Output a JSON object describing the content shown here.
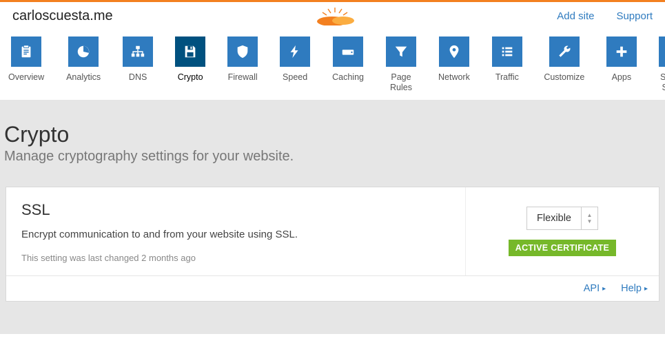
{
  "header": {
    "site_name": "carloscuesta.me",
    "links": {
      "add_site": "Add site",
      "support": "Support"
    }
  },
  "nav": {
    "items": [
      {
        "id": "overview",
        "label": "Overview",
        "icon": "clipboard"
      },
      {
        "id": "analytics",
        "label": "Analytics",
        "icon": "pie"
      },
      {
        "id": "dns",
        "label": "DNS",
        "icon": "sitemap"
      },
      {
        "id": "crypto",
        "label": "Crypto",
        "icon": "floppy",
        "active": true
      },
      {
        "id": "firewall",
        "label": "Firewall",
        "icon": "shield"
      },
      {
        "id": "speed",
        "label": "Speed",
        "icon": "bolt"
      },
      {
        "id": "caching",
        "label": "Caching",
        "icon": "drive"
      },
      {
        "id": "page-rules",
        "label": "Page Rules",
        "icon": "filter"
      },
      {
        "id": "network",
        "label": "Network",
        "icon": "pin"
      },
      {
        "id": "traffic",
        "label": "Traffic",
        "icon": "list"
      },
      {
        "id": "customize",
        "label": "Customize",
        "icon": "wrench"
      },
      {
        "id": "apps",
        "label": "Apps",
        "icon": "plus"
      },
      {
        "id": "scrape-shield",
        "label": "Scrape Shield",
        "icon": "doc"
      }
    ]
  },
  "page": {
    "title": "Crypto",
    "subtitle": "Manage cryptography settings for your website."
  },
  "ssl_card": {
    "title": "SSL",
    "description": "Encrypt communication to and from your website using SSL.",
    "changed_prefix": "This setting was last changed ",
    "changed_ago": "2 months ago",
    "select_value": "Flexible",
    "badge": "ACTIVE CERTIFICATE",
    "footer": {
      "api": "API",
      "help": "Help"
    }
  },
  "colors": {
    "brand_orange": "#f38020",
    "tile_blue": "#2f7bbf",
    "tile_active": "#00517f",
    "badge_green": "#76b82a"
  }
}
